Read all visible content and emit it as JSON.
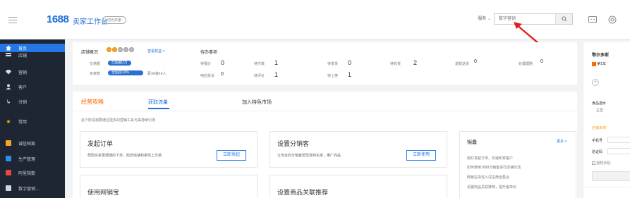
{
  "topbar": {
    "logo_num": "1688",
    "logo_text": "卖家工作台",
    "switch_label": "切为买家",
    "service_label": "服务",
    "search_placeholder": "数字营销"
  },
  "sidebar": {
    "items": [
      {
        "label": "首页",
        "icon": "home-icon"
      },
      {
        "label": "店铺",
        "icon": "store-icon"
      },
      {
        "label": "营销",
        "icon": "diamond-icon"
      },
      {
        "label": "客户",
        "icon": "user-icon"
      },
      {
        "label": "分销",
        "icon": "share-icon"
      },
      {
        "label": "常用",
        "icon": "star-icon"
      },
      {
        "label": "诚信档案",
        "icon": "archive-icon"
      },
      {
        "label": "生产管理",
        "icon": "production-icon"
      },
      {
        "label": "阿里指数",
        "icon": "chart-icon"
      },
      {
        "label": "数字营销...",
        "icon": "digital-icon"
      }
    ]
  },
  "overview": {
    "title": "店铺概况",
    "view_rights": "查看权益 >",
    "trade_label": "交易额",
    "trade_badge": "已超越2万",
    "buyer_label": "买家数",
    "buyer_badge": "全国前10%",
    "buyer_note": "距3A差14人"
  },
  "todo": {
    "title": "待办事项",
    "items": [
      {
        "label": "待报价",
        "value": "0"
      },
      {
        "label": "待付款",
        "value": "1"
      },
      {
        "label": "待发货",
        "value": "0"
      },
      {
        "label": "待收货",
        "value": "2"
      },
      {
        "label": "退款退货",
        "value": "0"
      },
      {
        "label": "处理理赔",
        "value": "0"
      },
      {
        "label": "响应投诉",
        "value": "0"
      },
      {
        "label": "待评价",
        "value": "1"
      },
      {
        "label": "待上架",
        "value": "1"
      }
    ]
  },
  "tabs": {
    "brand": "经营攻略",
    "items": [
      "获取流量",
      "加入特色市场"
    ],
    "intro": "这个阶段需要通过更多的营销工具与来持续引流"
  },
  "features": [
    {
      "title": "发起订单",
      "desc": "帮助买家更便捷的下单，助您快速积累线上交易",
      "button": "立即发起"
    },
    {
      "title": "设置分销客",
      "desc": "让专业的分销客帮您找到买家，推广商品",
      "button": "立即使用"
    },
    {
      "title": "使用网销宝",
      "desc": "",
      "button": ""
    },
    {
      "title": "设置商品关联推荐",
      "desc": "",
      "button": ""
    }
  ],
  "tips": {
    "title": "锦囊",
    "more": "更多 >",
    "lines": [
      "用好发起订单，快速积累客户",
      "如何使用1688分销客进行店铺引流",
      "网销宝由浅入深宝典全集合",
      "设置商品关联推荐，提升客单价"
    ]
  },
  "right_panel": {
    "name": "鄂尔多斯",
    "year_badge": "第1年",
    "plus": "+",
    "category": "食品酒水",
    "category_sub": "主营",
    "alert": "店铺未绑",
    "phone_label": "手机号",
    "code_label": "验证码",
    "agree_label": "授权手机"
  },
  "colors": {
    "brand_blue": "#1f6fd6",
    "sidebar_bg": "#1e2633",
    "active_item": "#2677e6",
    "brand_orange": "#ff6a00",
    "arrow_red": "#e02020"
  }
}
